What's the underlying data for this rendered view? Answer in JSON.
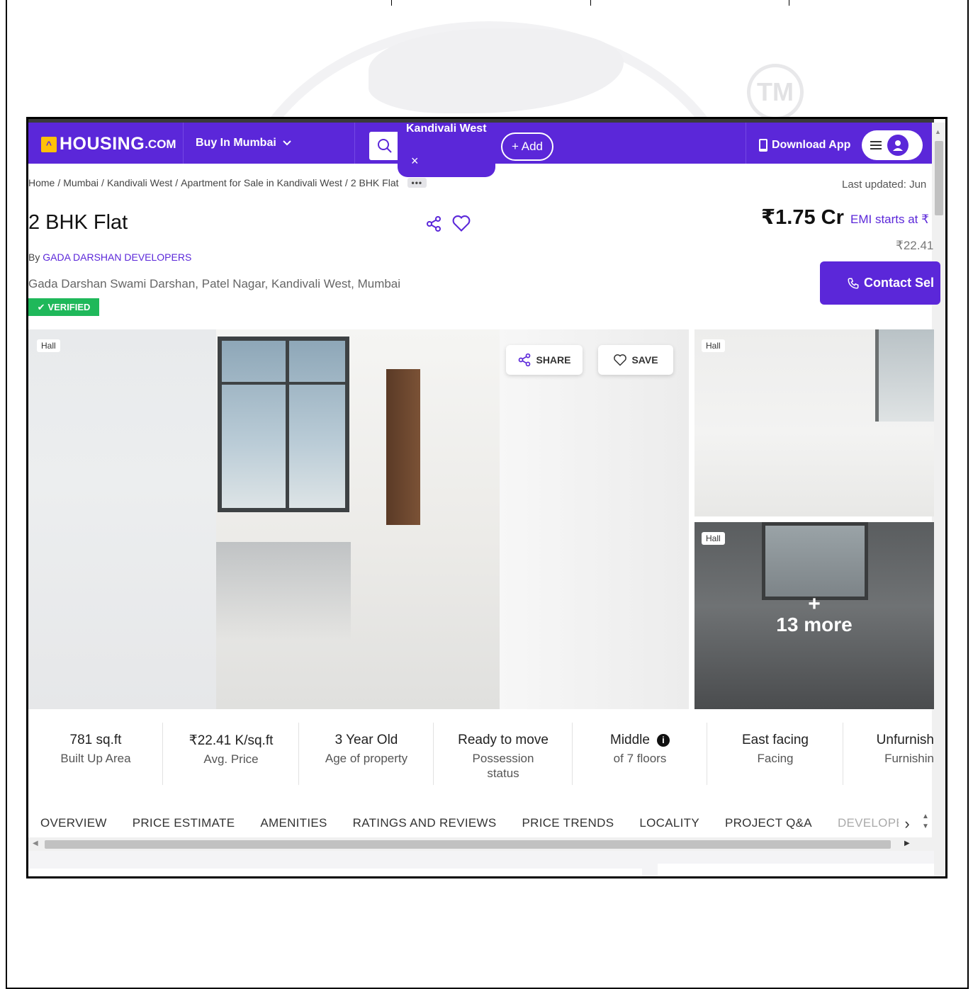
{
  "header": {
    "logo_text": "HOUSING",
    "logo_sub": ".COM",
    "buy_menu": "Buy In Mumbai",
    "search_tag": "Kandivali West",
    "search_tag_close": "×",
    "add_button": "+ Add",
    "download_app": "Download App"
  },
  "breadcrumb": {
    "items": [
      "Home",
      "Mumbai",
      "Kandivali West",
      "Apartment for Sale in Kandivali West",
      "2 BHK Flat"
    ],
    "separator": "/",
    "more": "•••"
  },
  "last_updated": "Last updated: Jun",
  "listing": {
    "title": "2 BHK Flat",
    "by_prefix": "By",
    "developer": "GADA DARSHAN DEVELOPERS",
    "address": "Gada Darshan Swami Darshan, Patel Nagar, Kandivali West, Mumbai",
    "verified": "VERIFIED",
    "price": "₹1.75 Cr",
    "emi": "EMI starts at ₹",
    "per_sqft": "₹22.41",
    "contact_button": "Contact Sel"
  },
  "gallery": {
    "main_tag": "Hall",
    "share": "SHARE",
    "save": "SAVE",
    "thumb_top_tag": "Hall",
    "thumb_bottom_tag": "Hall",
    "more_plus": "+",
    "more_text": "13 more"
  },
  "stats": [
    {
      "value": "781 sq.ft",
      "label": "Built Up Area"
    },
    {
      "value": "₹22.41 K/sq.ft",
      "label": "Avg. Price"
    },
    {
      "value": "3 Year Old",
      "label": "Age of property"
    },
    {
      "value": "Ready to move",
      "label": "Possession status"
    },
    {
      "value": "Middle",
      "label": "of 7 floors"
    },
    {
      "value": "East facing",
      "label": "Facing"
    },
    {
      "value": "Unfurnish",
      "label": "Furnishin"
    }
  ],
  "tabs": [
    "OVERVIEW",
    "PRICE ESTIMATE",
    "AMENITIES",
    "RATINGS AND REVIEWS",
    "PRICE TRENDS",
    "LOCALITY",
    "PROJECT Q&A",
    "DEVELOPER"
  ],
  "watermark": {
    "tm": "TM"
  },
  "colors": {
    "brand": "#5b27d9",
    "verified": "#1fb85a",
    "accent_yellow": "#ffc107"
  }
}
